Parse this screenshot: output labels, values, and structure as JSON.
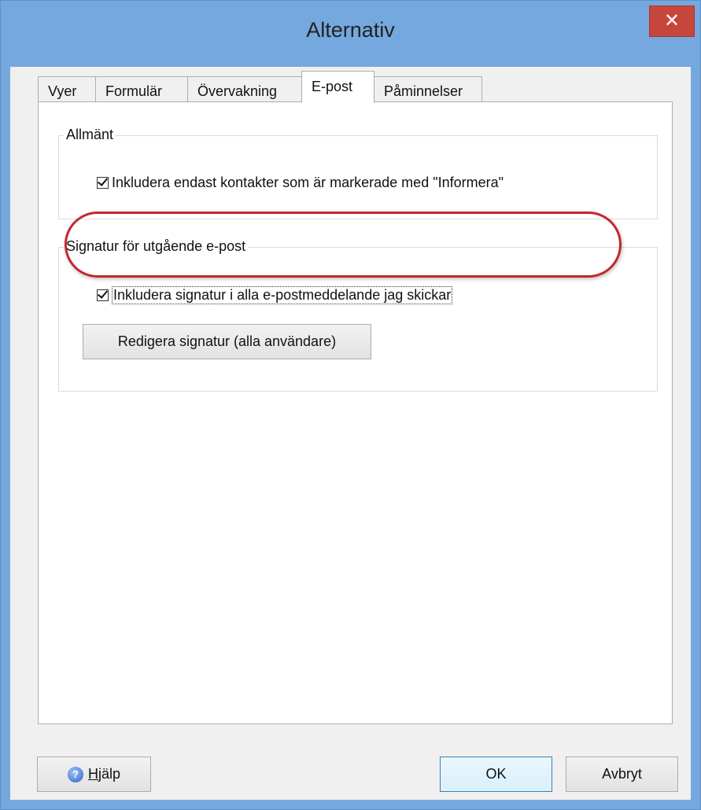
{
  "window": {
    "title": "Alternativ",
    "close_glyph": "✕",
    "accent": "#75a8de"
  },
  "tabs": [
    {
      "label": "Vyer",
      "active": false
    },
    {
      "label": "Formulär",
      "active": false
    },
    {
      "label": "Övervakning",
      "active": false
    },
    {
      "label": "E-post",
      "active": true
    },
    {
      "label": "Påminnelser",
      "active": false
    }
  ],
  "general_group": {
    "title": "Allmänt",
    "checkbox_label": "Inkludera endast kontakter som är markerade med \"Informera\"",
    "checked": true
  },
  "signature_group": {
    "title": "Signatur för utgående e-post",
    "checkbox_label": "Inkludera signatur i alla e-postmeddelande jag skickar",
    "checked": true,
    "edit_button_label": "Redigera signatur (alla användare)"
  },
  "footer": {
    "help": {
      "icon": "help-icon",
      "mnemonic": "H",
      "rest": "jälp"
    },
    "ok_label": "OK",
    "cancel_label": "Avbryt"
  },
  "annotation": {
    "color": "#c4262e"
  }
}
